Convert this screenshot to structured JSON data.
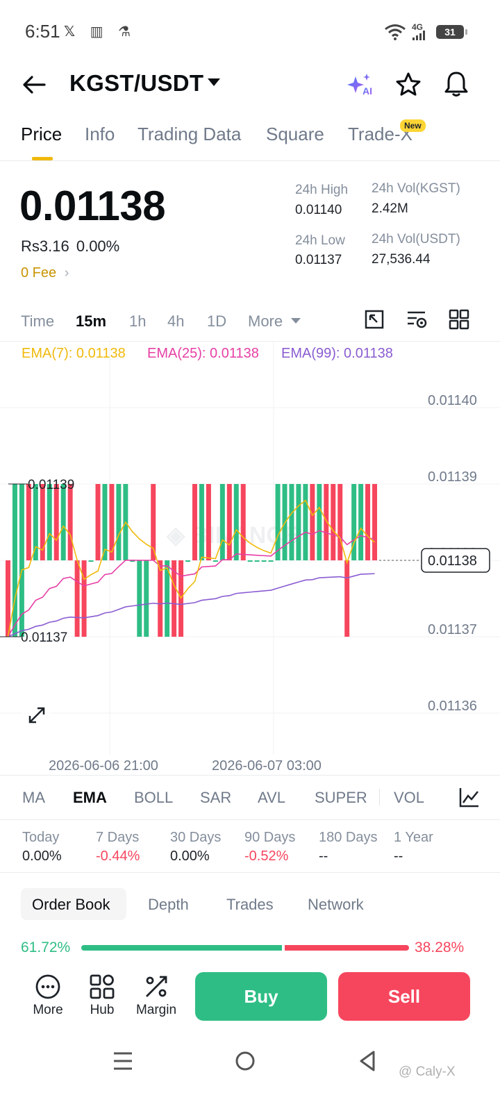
{
  "status_bar": {
    "time": "6:51",
    "network": "4G",
    "battery": "31"
  },
  "header": {
    "pair": "KGST/USDT"
  },
  "tabs": [
    {
      "label": "Price",
      "active": true
    },
    {
      "label": "Info"
    },
    {
      "label": "Trading Data"
    },
    {
      "label": "Square"
    },
    {
      "label": "Trade-X"
    }
  ],
  "new_badge": "New",
  "price": {
    "last": "0.01138",
    "fiat": "Rs3.16",
    "change": "0.00%",
    "fee": "0 Fee"
  },
  "stats": {
    "high_label": "24h High",
    "high": "0.01140",
    "low_label": "24h Low",
    "low": "0.01137",
    "vol_base_label": "24h Vol(KGST)",
    "vol_base": "2.42M",
    "vol_quote_label": "24h Vol(USDT)",
    "vol_quote": "27,536.44"
  },
  "intervals": [
    "Time",
    "15m",
    "1h",
    "4h",
    "1D",
    "More"
  ],
  "active_interval": "15m",
  "ema_legend": {
    "ema7": "EMA(7): 0.01138",
    "ema25": "EMA(25): 0.01138",
    "ema99": "EMA(99): 0.01138"
  },
  "colors": {
    "up": "#2ebd85",
    "down": "#f6465d",
    "ema7": "#f0b90b",
    "ema25": "#e63fa5",
    "ema99": "#8a5cd1",
    "accent": "#fcd535"
  },
  "chart_data": {
    "type": "candlestick",
    "y_ticks": [
      "0.01140",
      "0.01139",
      "0.01138",
      "0.01137",
      "0.01136"
    ],
    "current_price": "0.01138",
    "high_marker": "0.01139",
    "low_marker": "0.01137",
    "x_ticks": [
      "2026-06-06 21:00",
      "2026-06-07 03:00"
    ],
    "ylim": [
      0.011355,
      0.011405
    ],
    "candles": [
      {
        "o": 0.01138,
        "c": 0.01137,
        "d": 0
      },
      {
        "o": 0.01137,
        "c": 0.01139,
        "d": 1
      },
      {
        "o": 0.01137,
        "c": 0.01139,
        "d": 1
      },
      {
        "o": 0.01139,
        "c": 0.01138,
        "d": 0
      },
      {
        "o": 0.01138,
        "c": 0.01139,
        "d": 1
      },
      {
        "o": 0.01139,
        "c": 0.01138,
        "d": 0
      },
      {
        "o": 0.01138,
        "c": 0.01139,
        "d": 1
      },
      {
        "o": 0.01139,
        "c": 0.01138,
        "d": 0
      },
      {
        "o": 0.01138,
        "c": 0.01139,
        "d": 1
      },
      {
        "o": 0.01139,
        "c": 0.01138,
        "d": 0
      },
      {
        "o": 0.01138,
        "c": 0.01137,
        "d": 0
      },
      {
        "o": 0.01138,
        "c": 0.01137,
        "d": 0
      },
      {
        "o": 0.01138,
        "c": 0.01138,
        "d": 1
      },
      {
        "o": 0.01139,
        "c": 0.01138,
        "d": 0
      },
      {
        "o": 0.01138,
        "c": 0.01139,
        "d": 1
      },
      {
        "o": 0.01139,
        "c": 0.01138,
        "d": 0
      },
      {
        "o": 0.01138,
        "c": 0.01139,
        "d": 1
      },
      {
        "o": 0.01138,
        "c": 0.01139,
        "d": 1
      },
      {
        "o": 0.01138,
        "c": 0.01138,
        "d": 1
      },
      {
        "o": 0.01137,
        "c": 0.01138,
        "d": 1
      },
      {
        "o": 0.01137,
        "c": 0.01138,
        "d": 1
      },
      {
        "o": 0.01139,
        "c": 0.01138,
        "d": 0
      },
      {
        "o": 0.01138,
        "c": 0.01137,
        "d": 0
      },
      {
        "o": 0.01137,
        "c": 0.01138,
        "d": 1
      },
      {
        "o": 0.01138,
        "c": 0.01137,
        "d": 0
      },
      {
        "o": 0.01138,
        "c": 0.01137,
        "d": 0
      },
      {
        "o": 0.01138,
        "c": 0.01138,
        "d": 1
      },
      {
        "o": 0.01139,
        "c": 0.01138,
        "d": 0
      },
      {
        "o": 0.01138,
        "c": 0.01139,
        "d": 1
      },
      {
        "o": 0.01139,
        "c": 0.01138,
        "d": 0
      },
      {
        "o": 0.01138,
        "c": 0.01138,
        "d": 1
      },
      {
        "o": 0.01138,
        "c": 0.01139,
        "d": 1
      },
      {
        "o": 0.01139,
        "c": 0.01138,
        "d": 0
      },
      {
        "o": 0.01138,
        "c": 0.01139,
        "d": 1
      },
      {
        "o": 0.01139,
        "c": 0.01138,
        "d": 0
      },
      {
        "o": 0.01138,
        "c": 0.01138,
        "d": 1
      },
      {
        "o": 0.01138,
        "c": 0.01138,
        "d": 1
      },
      {
        "o": 0.01138,
        "c": 0.01138,
        "d": 1
      },
      {
        "o": 0.01138,
        "c": 0.01138,
        "d": 1
      },
      {
        "o": 0.01138,
        "c": 0.01139,
        "d": 1
      },
      {
        "o": 0.01138,
        "c": 0.01139,
        "d": 1
      },
      {
        "o": 0.01138,
        "c": 0.01139,
        "d": 1
      },
      {
        "o": 0.01138,
        "c": 0.01139,
        "d": 1
      },
      {
        "o": 0.01138,
        "c": 0.01139,
        "d": 1
      },
      {
        "o": 0.01139,
        "c": 0.01138,
        "d": 0
      },
      {
        "o": 0.01138,
        "c": 0.01139,
        "d": 1
      },
      {
        "o": 0.01139,
        "c": 0.01138,
        "d": 0
      },
      {
        "o": 0.01139,
        "c": 0.01138,
        "d": 0
      },
      {
        "o": 0.01139,
        "c": 0.01138,
        "d": 0
      },
      {
        "o": 0.01138,
        "c": 0.01137,
        "d": 0
      },
      {
        "o": 0.01138,
        "c": 0.01139,
        "d": 1
      },
      {
        "o": 0.01138,
        "c": 0.01139,
        "d": 1
      },
      {
        "o": 0.01139,
        "c": 0.01138,
        "d": 0
      },
      {
        "o": 0.01139,
        "c": 0.01138,
        "d": 0
      }
    ]
  },
  "indicators": [
    "MA",
    "EMA",
    "BOLL",
    "SAR",
    "AVL",
    "SUPER",
    "VOL"
  ],
  "active_indicator": "EMA",
  "periods": [
    {
      "label": "Today",
      "value": "0.00%",
      "neg": false
    },
    {
      "label": "7 Days",
      "value": "-0.44%",
      "neg": true
    },
    {
      "label": "30 Days",
      "value": "0.00%",
      "neg": false
    },
    {
      "label": "90 Days",
      "value": "-0.52%",
      "neg": true
    },
    {
      "label": "180 Days",
      "value": "--",
      "neg": false
    },
    {
      "label": "1 Year",
      "value": "--",
      "neg": false
    }
  ],
  "orderbook_tabs": [
    "Order Book",
    "Depth",
    "Trades",
    "Network"
  ],
  "ratio": {
    "buy": "61.72%",
    "sell": "38.28%",
    "buy_fraction": 0.6172
  },
  "actions": [
    {
      "label": "More",
      "icon": "more-icon"
    },
    {
      "label": "Hub",
      "icon": "hub-icon"
    },
    {
      "label": "Margin",
      "icon": "margin-icon"
    }
  ],
  "buy_label": "Buy",
  "sell_label": "Sell",
  "watermark": "@ Caly-X"
}
